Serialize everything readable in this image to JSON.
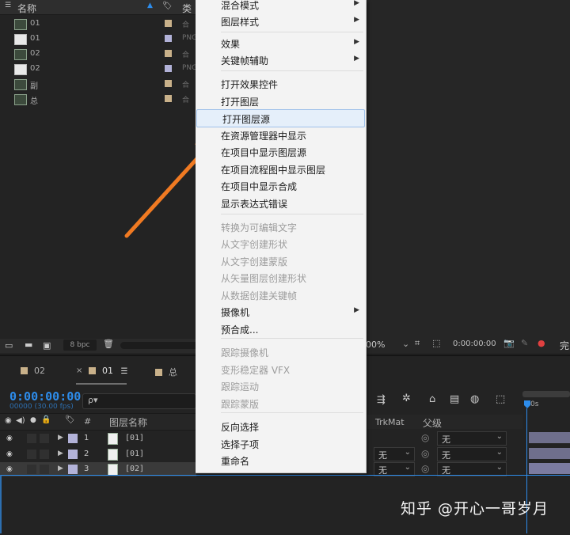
{
  "project_panel": {
    "column_name": "名称",
    "column_type": "类",
    "rows": [
      {
        "name": "01",
        "type": "合",
        "kind": "comp",
        "label_color": "#c9b18a"
      },
      {
        "name": "01",
        "type": "PNG",
        "kind": "png",
        "label_color": "#b2b2d8"
      },
      {
        "name": "02",
        "type": "合",
        "kind": "comp",
        "label_color": "#c9b18a"
      },
      {
        "name": "02",
        "type": "PNG",
        "kind": "png",
        "label_color": "#b2b2d8"
      },
      {
        "name": "副",
        "type": "合",
        "kind": "comp",
        "label_color": "#c9b18a"
      },
      {
        "name": "总",
        "type": "合",
        "kind": "comp",
        "label_color": "#c9b18a"
      }
    ],
    "bpc": "8 bpc"
  },
  "viewer_footer": {
    "zoom": "00%",
    "timecode": "0:00:00:00",
    "complete_label": "完"
  },
  "timeline": {
    "tabs": [
      {
        "label": "02",
        "color": "#c9b18a"
      },
      {
        "label": "01",
        "color": "#c9b18a",
        "active": true
      },
      {
        "label": "总",
        "color": "#c9b18a"
      }
    ],
    "timecode": "0:00:00:00",
    "fps": "00000 (30.00 fps)",
    "search_placeholder": "ρ▾",
    "columns": {
      "hash": "#",
      "layer_name": "图层名称",
      "trkmat": "TrkMat",
      "parent": "父级"
    },
    "ruler_start": "0s",
    "layers": [
      {
        "num": "1",
        "name": "[01]",
        "trkmat": "",
        "parent": "无"
      },
      {
        "num": "2",
        "name": "[01]",
        "trkmat": "无",
        "parent": "无"
      },
      {
        "num": "3",
        "name": "[02]",
        "trkmat": "无",
        "parent": "无",
        "selected": true
      }
    ]
  },
  "context_menu": {
    "items": [
      {
        "label": "混合模式",
        "submenu": true
      },
      {
        "label": "图层样式",
        "submenu": true
      },
      {
        "label": "效果",
        "submenu": true
      },
      {
        "label": "关键帧辅助",
        "submenu": true
      },
      {
        "label": "打开效果控件"
      },
      {
        "label": "打开图层"
      },
      {
        "label": "打开图层源",
        "highlighted": true
      },
      {
        "label": "在资源管理器中显示"
      },
      {
        "label": "在项目中显示图层源"
      },
      {
        "label": "在项目流程图中显示图层"
      },
      {
        "label": "在项目中显示合成"
      },
      {
        "label": "显示表达式错误"
      },
      {
        "label": "转换为可编辑文字",
        "disabled": true
      },
      {
        "label": "从文字创建形状",
        "disabled": true
      },
      {
        "label": "从文字创建蒙版",
        "disabled": true
      },
      {
        "label": "从矢量图层创建形状",
        "disabled": true
      },
      {
        "label": "从数据创建关键帧",
        "disabled": true
      },
      {
        "label": "摄像机",
        "submenu": true
      },
      {
        "label": "预合成..."
      },
      {
        "label": "跟踪摄像机",
        "disabled": true
      },
      {
        "label": "变形稳定器 VFX",
        "disabled": true
      },
      {
        "label": "跟踪运动",
        "disabled": true
      },
      {
        "label": "跟踪蒙版",
        "disabled": true
      },
      {
        "label": "反向选择"
      },
      {
        "label": "选择子项"
      },
      {
        "label": "重命名"
      }
    ]
  },
  "watermark": "知乎 @开心一哥岁月",
  "colors": {
    "accent": "#2d8ceb",
    "arrow": "#f07a22",
    "menu_bg": "#f3f3f3",
    "highlight": "#e5effa"
  }
}
